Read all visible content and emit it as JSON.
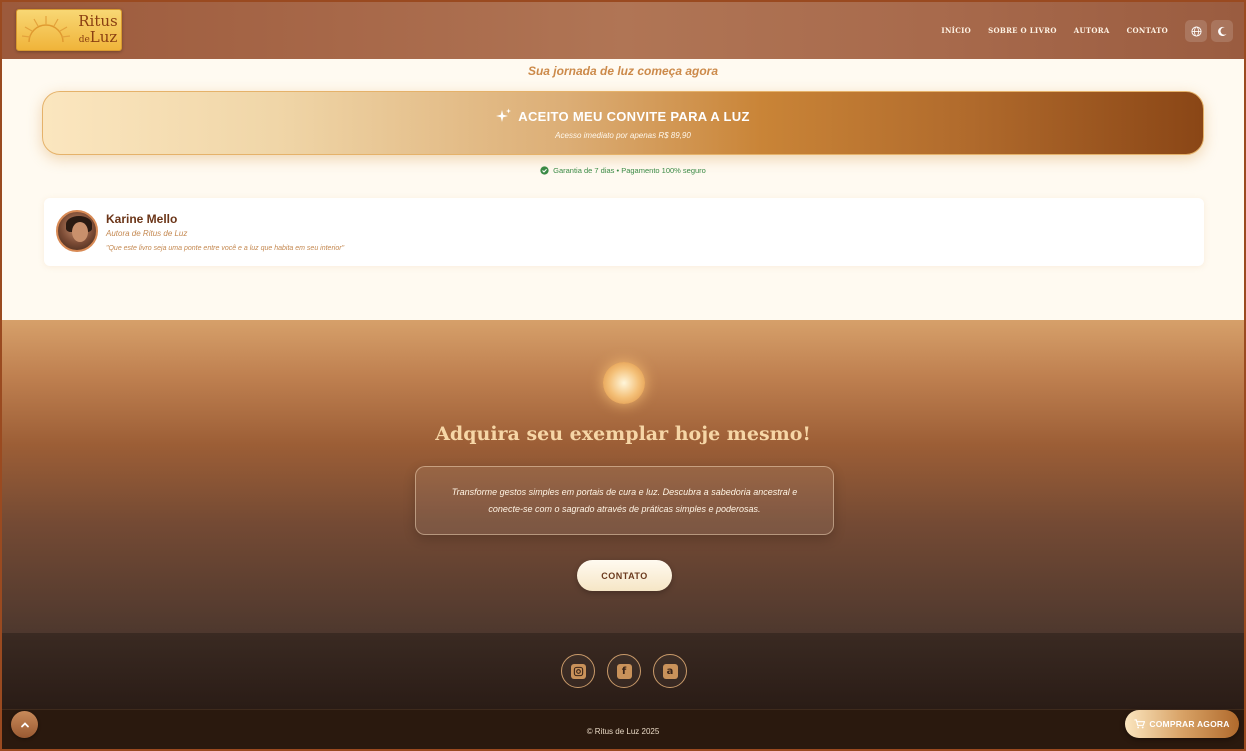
{
  "header": {
    "logo": {
      "line1": "Ritus",
      "line2_small": "de",
      "line2": "Luz"
    },
    "nav": [
      "INÍCIO",
      "SOBRE O LIVRO",
      "AUTORA",
      "CONTATO"
    ],
    "icons": [
      "globe-icon",
      "moon-icon"
    ]
  },
  "hero": {
    "tagline": "Sua jornada de luz começa agora",
    "cta_label": "ACEITO MEU CONVITE PARA A LUZ",
    "cta_sub": "Acesso imediato por apenas R$ 89,90",
    "guarantee": "Garantia de 7 dias • Pagamento 100% seguro"
  },
  "author": {
    "name": "Karine Mello",
    "role": "Autora de Ritus de Luz",
    "quote": "\"Que este livro seja uma ponte entre você e a luz que habita em seu interior\""
  },
  "buy": {
    "title": "Adquira seu exemplar hoje mesmo!",
    "description": "Transforme gestos simples em portais de cura e luz. Descubra a sabedoria ancestral e conecte-se com o sagrado através de práticas simples e poderosas.",
    "contact_label": "CONTATO"
  },
  "footer": {
    "social": [
      "instagram-icon",
      "facebook-icon",
      "amazon-icon"
    ],
    "copyright": "© Ritus de Luz 2025"
  },
  "floating": {
    "buy_now_label": "COMPRAR AGORA"
  },
  "colors": {
    "accent": "#c98437",
    "brand_dark": "#6b3518",
    "guarantee_green": "#3a8a45"
  }
}
